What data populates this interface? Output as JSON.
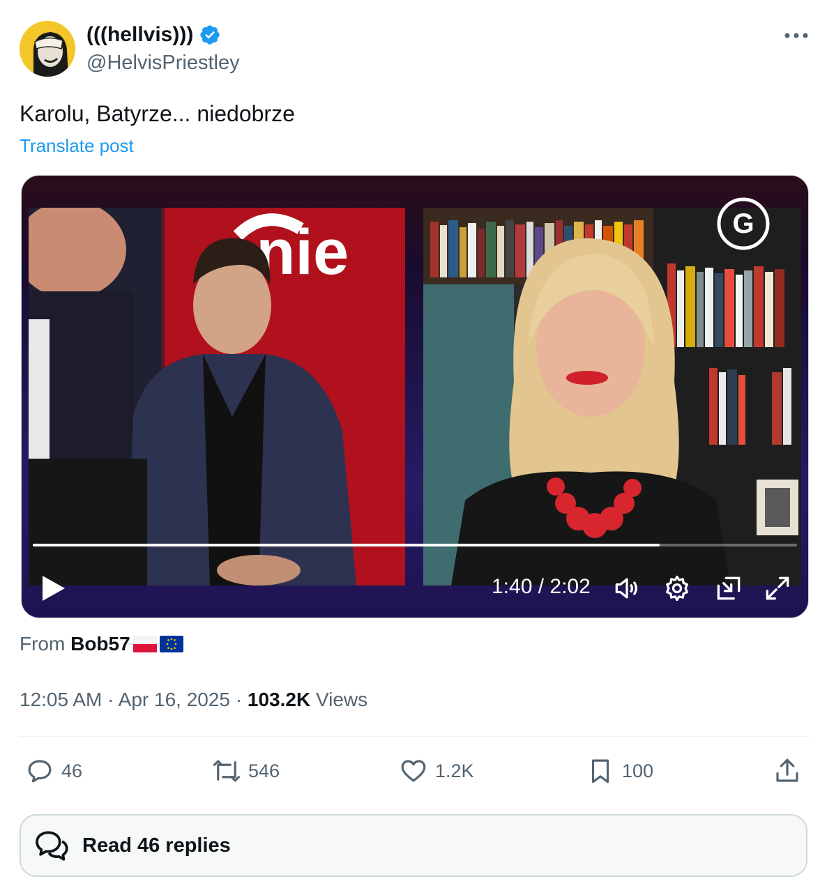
{
  "author": {
    "display_name": "(((hellvis)))",
    "handle": "@HelvisPriestley",
    "verified": true,
    "avatar_icon": "avatar-facepalm"
  },
  "post": {
    "text": "Karolu, Batyrze... niedobrze",
    "translate_label": "Translate post"
  },
  "video": {
    "logo": "G",
    "studio_sign_text": "onie",
    "current_time": "1:40",
    "separator": " / ",
    "duration": "2:02",
    "progress": 0.82,
    "controls": [
      "play-icon",
      "volume-icon",
      "settings-icon",
      "pip-icon",
      "fullscreen-icon"
    ]
  },
  "source": {
    "prefix": "From",
    "name": "Bob57",
    "flags": [
      "flag-poland",
      "flag-eu"
    ]
  },
  "meta": {
    "time": "12:05 AM",
    "dot": "·",
    "date": "Apr 16, 2025",
    "views_count": "103.2K",
    "views_label": "Views"
  },
  "actions": {
    "replies": "46",
    "reposts": "546",
    "likes": "1.2K",
    "bookmarks": "100"
  },
  "read_replies_label": "Read 46 replies",
  "colors": {
    "accent": "#1d9bf0",
    "secondary_text": "#536471",
    "primary_text": "#0f1419"
  }
}
